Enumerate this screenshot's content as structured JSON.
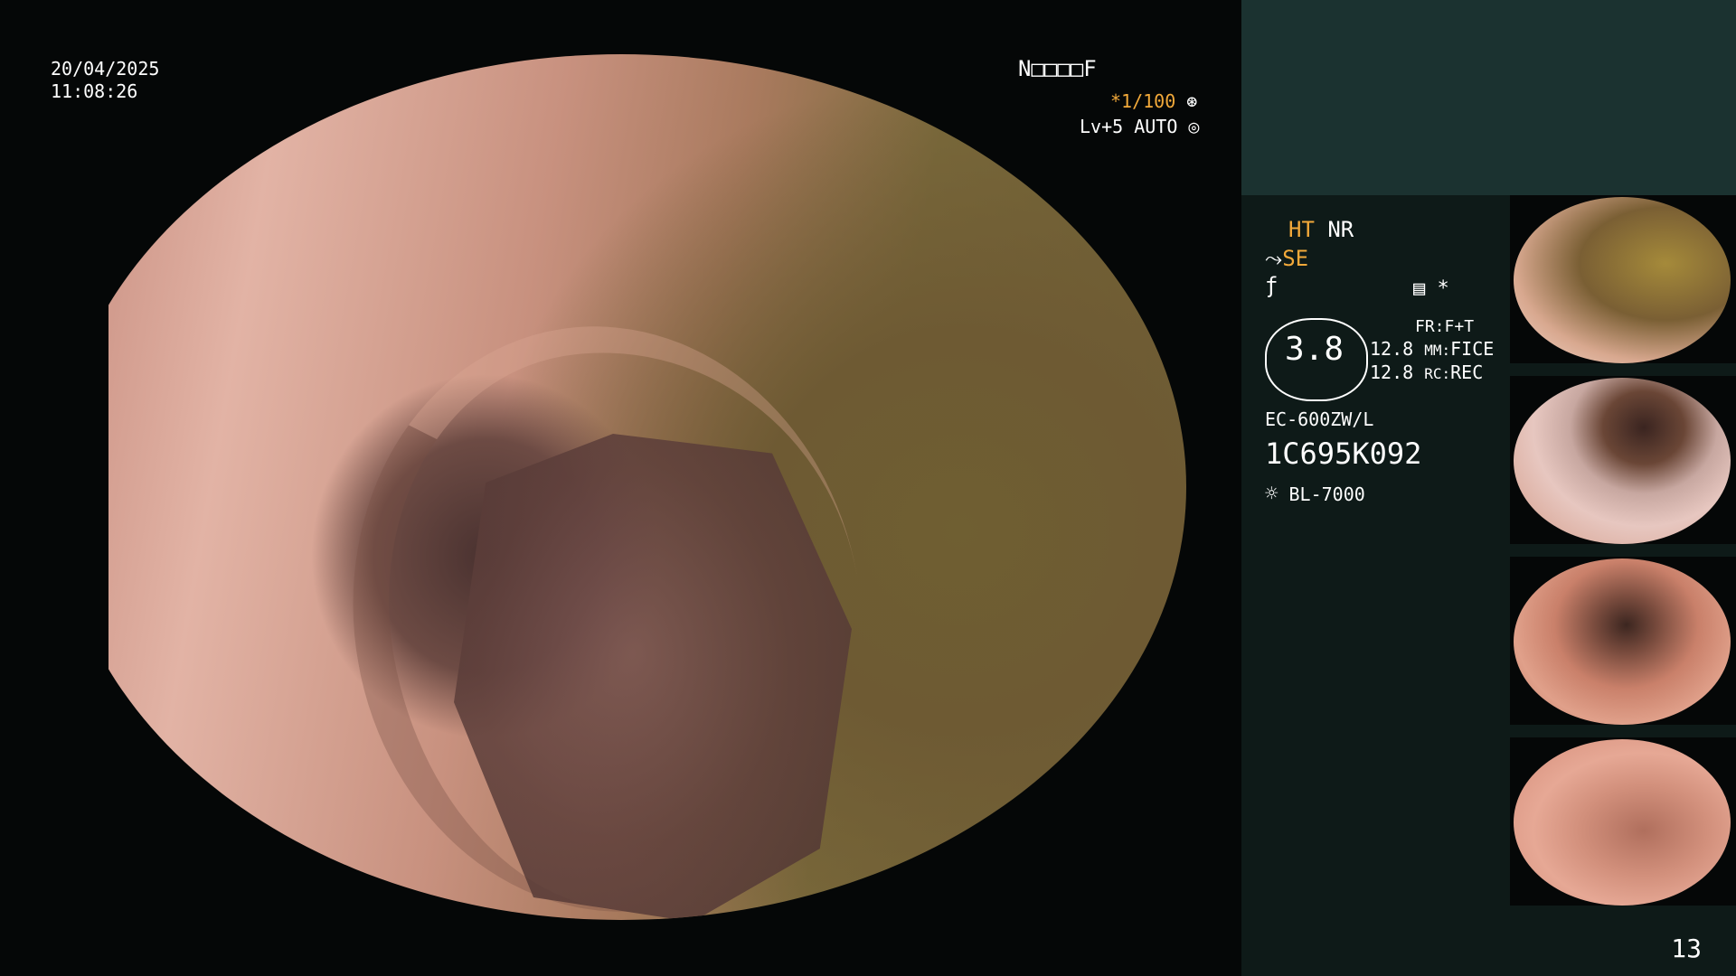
{
  "overlay": {
    "date": "20/04/2025",
    "time": "11:08:26",
    "patient_id": "N□□□□F",
    "shutter": "*1/100",
    "level": "Lv+5 AUTO"
  },
  "panel": {
    "ht": "HT",
    "nr": "NR",
    "se": "SE",
    "fr_label": "FR:",
    "fr_value": "F+T",
    "mm_label": "MM:",
    "mm_value": "FICE",
    "rc_label": "RC:",
    "rc_value": "REC",
    "zoom": "3.8",
    "val1": "12.8",
    "val2": "12.8",
    "scope_model": "EC-600ZW/L",
    "serial": "1C695K092",
    "light": "BL-7000",
    "page_number": "13",
    "asterisk": "*"
  },
  "colors": {
    "accent_orange": "#f2a93a",
    "panel_bg": "#0e1a18",
    "panel_top_bg": "#1b3230"
  },
  "thumbnails": [
    {
      "name": "thumb-1"
    },
    {
      "name": "thumb-2"
    },
    {
      "name": "thumb-3"
    },
    {
      "name": "thumb-4"
    }
  ]
}
